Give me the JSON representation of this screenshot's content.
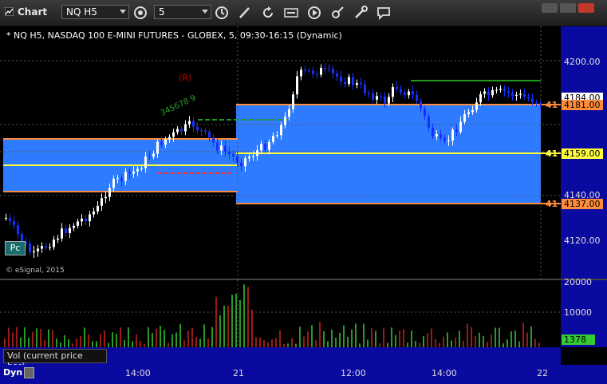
{
  "window": {
    "title": "Chart"
  },
  "toolbar": {
    "symbol_value": "NQ H5",
    "interval_value": "5",
    "icons": [
      "cycle-icon",
      "clock-icon",
      "pencil-icon",
      "refresh-icon",
      "quote-icon",
      "play-icon",
      "tools-icon",
      "comment-icon"
    ]
  },
  "chart": {
    "title": "* NQ H5, NASDAQ 100 E-MINI FUTURES - GLOBEX, 5, 09:30-16:15 (Dynamic)",
    "copyright": "© eSignal, 2015",
    "pc_badge": "Pc",
    "r_marker": "(R)",
    "count_label": "345678 9",
    "price_ticks": [
      "4200.00",
      "4180.00",
      "4160.00",
      "4140.00",
      "4120.00"
    ],
    "price_tags": {
      "current": "4184.00",
      "orange_upper": "4181.00",
      "yellow": "4159.00",
      "orange_lower": "4137.00",
      "orange_upper_left": "41",
      "yellow_left": "41",
      "orange_lower_left": "41"
    },
    "time_ticks": [
      "14:00",
      "21",
      "12:00",
      "14:00",
      "22"
    ],
    "colors": {
      "zone_blue": "#2e7bff",
      "orange_line": "#ff8c3a",
      "yellow_line": "#ffff40",
      "green_line": "#1f9a1f",
      "red_dash": "#ff2b2b",
      "up_bar": "#ffffff",
      "down_bar": "#1530ff",
      "axis_bg": "#0a0aa0"
    }
  },
  "volume": {
    "ticks": [
      "20000",
      "10000"
    ],
    "current_tag": "1378",
    "study_label": "Vol (current price bar)"
  },
  "statusbar": {
    "mode_label": "Dyn"
  }
}
